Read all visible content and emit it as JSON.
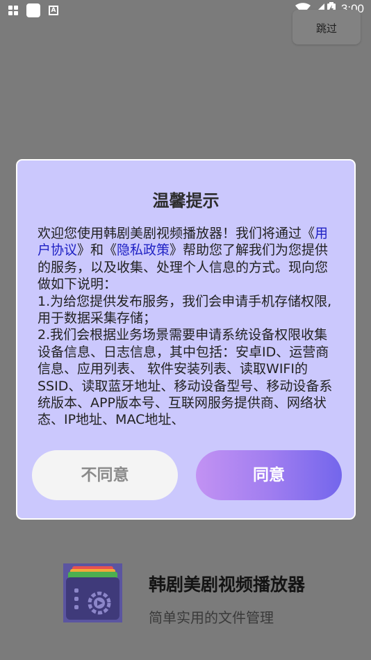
{
  "status_bar": {
    "time": "3:00",
    "notification_icon_letter": "A",
    "icons": [
      "grid-notification-icon",
      "square-notification-icon",
      "a-notification-icon",
      "wifi-icon",
      "signal-icon",
      "battery-charging-icon"
    ]
  },
  "skip": {
    "label": "跳过"
  },
  "dialog": {
    "title": "温馨提示",
    "intro_pre": "欢迎您使用韩剧美剧视频播放器！我们将通过",
    "open_quote_1": "《",
    "user_agreement": "用户协议",
    "mid": "》和《",
    "privacy_policy": "隐私政策",
    "intro_post": "》帮助您了解我们为您提供的服务，以及收集、处理个人信息的方式。现向您做如下说明：",
    "item1": "1.为给您提供发布服务，我们会申请手机存储权限, 用于数据采集存储；",
    "item2": "2.我们会根据业务场景需要申请系统设备权限收集设备信息、日志信息，其中包括：安卓ID、运营商信息、应用列表、 软件安装列表、读取WIFI的SSID、读取蓝牙地址、移动设备型号、移动设备系统版本、APP版本号、互联网服务提供商、网络状态、IP地址、MAC地址、",
    "disagree_label": "不同意",
    "agree_label": "同意",
    "colors": {
      "background": "#cbc8fd",
      "link": "#1f21c4",
      "agree_gradient_start": "#c292f3",
      "agree_gradient_end": "#7366ec"
    }
  },
  "splash": {
    "app_name": "韩剧美剧视频播放器",
    "slogan": "简单实用的文件管理",
    "logo_icon": "file-folder-video-icon"
  }
}
